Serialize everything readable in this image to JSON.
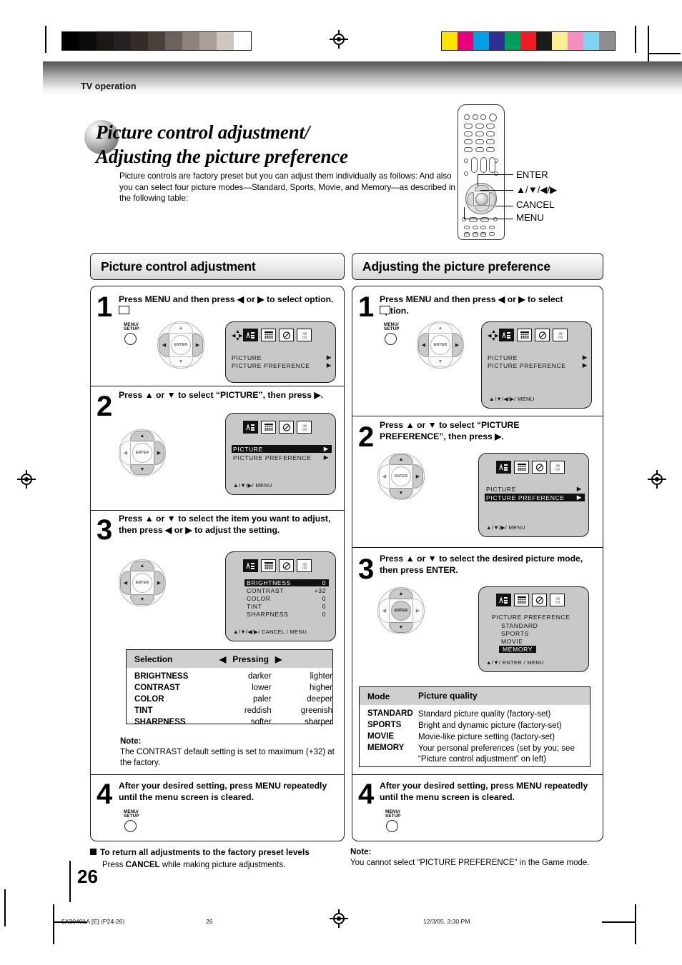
{
  "header": {
    "section_label": "TV operation"
  },
  "title": {
    "line1": "Picture control adjustment/",
    "line2": "Adjusting the picture preference",
    "intro": "Picture controls are factory preset but you can adjust them individually as follows: And also you can select four picture modes—Standard, Sports, Movie, and Memory—as described in the following table:"
  },
  "remote": {
    "labels": {
      "enter": "ENTER",
      "arrows": "▲/▼/◀/▶",
      "cancel": "CANCEL",
      "menu": "MENU"
    }
  },
  "left_column": {
    "heading": "Picture control adjustment",
    "step1": {
      "number": "1",
      "text": "Press MENU and then press ◀ or ▶ to select  option.",
      "button_label_line1": "MENU/",
      "button_label_line2": "SETUP",
      "dpad_center": "ENTER",
      "osd": {
        "rows": [
          {
            "label": "PICTURE",
            "arrow": "▶",
            "highlight": false
          },
          {
            "label": "PICTURE  PREFERENCE",
            "arrow": "▶",
            "highlight": false
          }
        ],
        "hint": ""
      }
    },
    "step2": {
      "number": "2",
      "text": "Press ▲ or ▼ to select “PICTURE”, then press ▶.",
      "dpad_center": "ENTER",
      "osd": {
        "rows": [
          {
            "label": "PICTURE",
            "arrow": "▶",
            "highlight": true
          },
          {
            "label": "PICTURE  PREFERENCE",
            "arrow": "▶",
            "highlight": false
          }
        ],
        "hint": "▲/▼/▶/ MENU"
      }
    },
    "step3": {
      "number": "3",
      "text": "Press ▲ or ▼ to select the item you want to adjust, then press ◀ or ▶ to adjust the setting.",
      "dpad_center": "ENTER",
      "osd": {
        "rows": [
          {
            "label": "BRIGHTNESS",
            "value": "0",
            "highlight": true
          },
          {
            "label": "CONTRAST",
            "value": "+32",
            "highlight": false
          },
          {
            "label": "COLOR",
            "value": "0",
            "highlight": false
          },
          {
            "label": "TINT",
            "value": "0",
            "highlight": false
          },
          {
            "label": "SHARPNESS",
            "value": "0",
            "highlight": false
          }
        ],
        "hint": "▲/▼/◀/▶/ CANCEL / MENU"
      }
    },
    "selection_table": {
      "header_selection": "Selection",
      "header_left_arrow": "◀",
      "header_pressing": "Pressing",
      "header_right_arrow": "▶",
      "rows": [
        {
          "selection": "BRIGHTNESS",
          "left": "darker",
          "right": "lighter"
        },
        {
          "selection": "CONTRAST",
          "left": "lower",
          "right": "higher"
        },
        {
          "selection": "COLOR",
          "left": "paler",
          "right": "deeper"
        },
        {
          "selection": "TINT",
          "left": "reddish",
          "right": "greenish"
        },
        {
          "selection": "SHARPNESS",
          "left": "softer",
          "right": "sharper"
        }
      ]
    },
    "note": {
      "title": "Note:",
      "body": "The CONTRAST default setting is set to maximum (+32) at the factory."
    },
    "step4": {
      "number": "4",
      "text": "After your desired setting, press MENU repeatedly until the menu screen is cleared.",
      "button_label_line1": "MENU/",
      "button_label_line2": "SETUP"
    },
    "footer_note": {
      "heading": "To return all adjustments to the factory preset levels",
      "body_pre": "Press ",
      "body_bold": "CANCEL",
      "body_post": " while making picture adjustments."
    }
  },
  "right_column": {
    "heading": "Adjusting the picture preference",
    "step1": {
      "number": "1",
      "text": "Press MENU and then press ◀ or ▶ to select  option.",
      "button_label_line1": "MENU/",
      "button_label_line2": "SETUP",
      "dpad_center": "ENTER",
      "osd": {
        "rows": [
          {
            "label": "PICTURE",
            "arrow": "▶",
            "highlight": false
          },
          {
            "label": "PICTURE  PREFERENCE",
            "arrow": "▶",
            "highlight": false
          }
        ],
        "hint": "▲/▼/◀/▶/ MENU"
      }
    },
    "step2": {
      "number": "2",
      "text": "Press ▲ or ▼ to select “PICTURE PREFERENCE”, then press ▶.",
      "dpad_center": "ENTER",
      "osd": {
        "rows": [
          {
            "label": "PICTURE",
            "arrow": "▶",
            "highlight": false
          },
          {
            "label": "PICTURE  PREFERENCE",
            "arrow": "▶",
            "highlight": true
          }
        ],
        "hint": "▲/▼/▶/ MENU"
      }
    },
    "step3": {
      "number": "3",
      "text": "Press ▲ or ▼ to select the desired picture mode, then press ENTER.",
      "dpad_center": "ENTER",
      "osd": {
        "title": "PICTURE PREFERENCE",
        "rows": [
          {
            "label": "STANDARD",
            "highlight": false
          },
          {
            "label": "SPORTS",
            "highlight": false
          },
          {
            "label": "MOVIE",
            "highlight": false
          },
          {
            "label": "MEMORY",
            "highlight": true
          }
        ],
        "hint": "▲/▼/ ENTER / MENU"
      }
    },
    "mode_table": {
      "header_mode": "Mode",
      "header_quality": "Picture quality",
      "rows": [
        {
          "mode": "STANDARD",
          "quality": "Standard picture quality (factory-set)"
        },
        {
          "mode": "SPORTS",
          "quality": "Bright and dynamic picture (factory-set)"
        },
        {
          "mode": "MOVIE",
          "quality": "Movie-like picture setting (factory-set)"
        },
        {
          "mode": "MEMORY",
          "quality": "Your personal preferences (set by you; see “Picture control adjustment” on left)"
        }
      ]
    },
    "step4": {
      "number": "4",
      "text": "After your desired setting, press MENU repeatedly until the menu screen is cleared.",
      "button_label_line1": "MENU/",
      "button_label_line2": "SETUP"
    },
    "footer_note": {
      "title": "Note:",
      "body": "You cannot select “PICTURE PREFERENCE” in the Game mode."
    }
  },
  "footer": {
    "page_number": "26",
    "file_id": "5X30401A [E] (P24-26)",
    "sheet_number": "26",
    "timestamp": "12/3/05, 3:30 PM"
  },
  "print_marks": {
    "greyscale_swatches": [
      "#000000",
      "#0d0a0a",
      "#1c1715",
      "#262020",
      "#342c29",
      "#4a403c",
      "#6d615c",
      "#8e827d",
      "#ab9f9a",
      "#cfc6c1",
      "#ffffff"
    ],
    "color_swatches": [
      "#fbe400",
      "#e6007e",
      "#00a0e4",
      "#2e3192",
      "#00a05a",
      "#ee1c25",
      "#1c1a1a",
      "#fbef8f",
      "#f58fc2",
      "#7fd4f4",
      "#8e8e8e"
    ]
  }
}
